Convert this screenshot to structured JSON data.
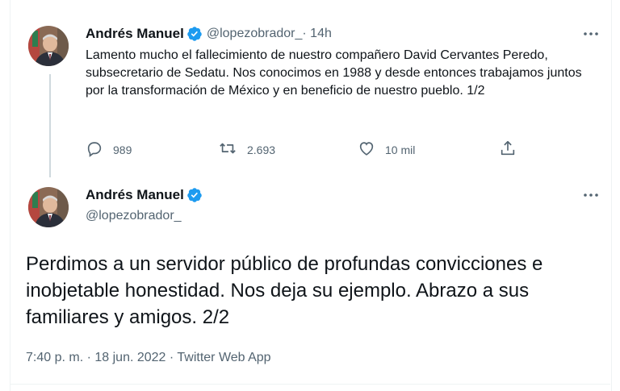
{
  "colors": {
    "verified_badge": "#1d9bf0",
    "secondary_text": "#536471",
    "primary_text": "#0f1419"
  },
  "tweet1": {
    "author_name": "Andrés Manuel",
    "handle": "@lopezobrador_",
    "time": " · 14h",
    "text": "Lamento mucho el fallecimiento de nuestro compañero David Cervantes Peredo, subsecretario de Sedatu. Nos conocimos en 1988 y desde entonces trabajamos juntos por la transformación de México y en beneficio de nuestro pueblo. 1/2",
    "replies": "989",
    "retweets": "2.693",
    "likes": "10 mil",
    "icons": [
      "reply-icon",
      "retweet-icon",
      "like-icon",
      "share-icon",
      "more-icon"
    ]
  },
  "tweet2": {
    "author_name": "Andrés Manuel",
    "handle": "@lopezobrador_",
    "text": "Perdimos a un servidor público de profundas convicciones e inobjetable honestidad. Nos deja su ejemplo. Abrazo a sus familiares y amigos. 2/2",
    "meta": "7:40 p. m. · 18 jun. 2022 · Twitter Web App"
  }
}
